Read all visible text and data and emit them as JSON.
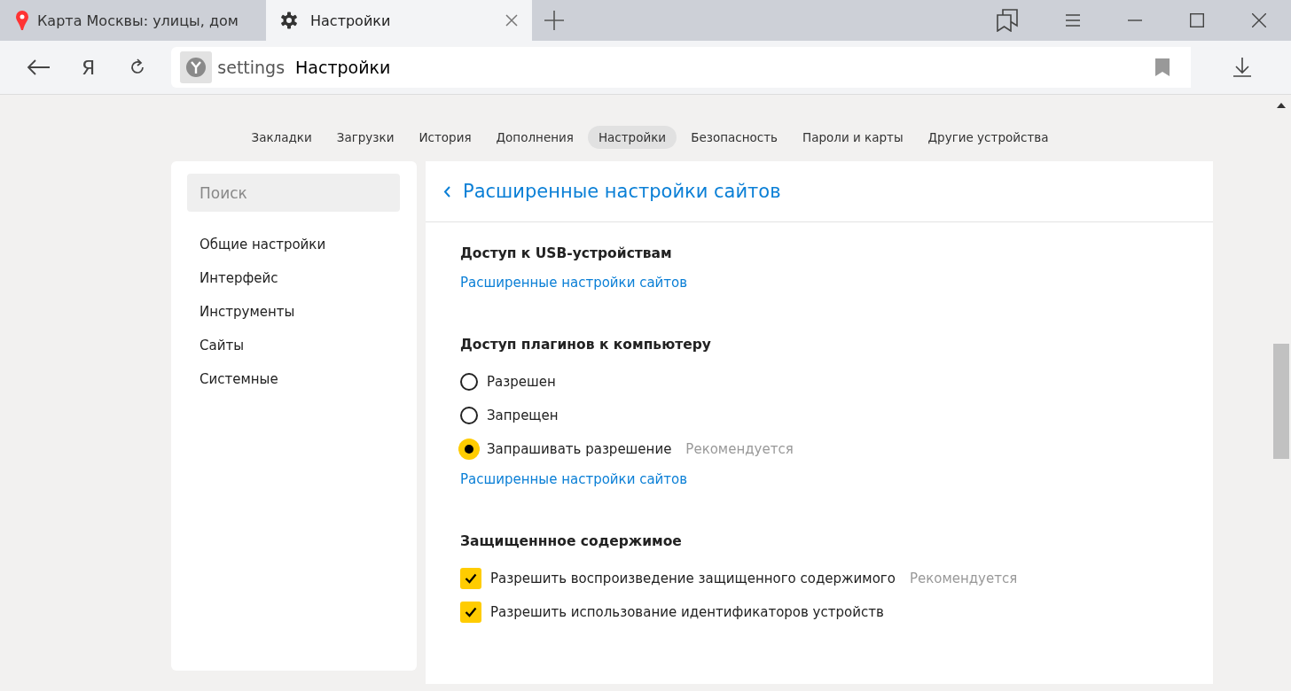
{
  "browser_tabs": [
    {
      "title": "Карта Москвы: улицы, дом",
      "kind": "map",
      "selected": false
    },
    {
      "title": "Настройки",
      "kind": "settings",
      "selected": true
    }
  ],
  "toolbar": {
    "yandex_button": "Я"
  },
  "address_bar": {
    "scheme": "settings",
    "title": "Настройки"
  },
  "nav": [
    {
      "label": "Закладки",
      "selected": false
    },
    {
      "label": "Загрузки",
      "selected": false
    },
    {
      "label": "История",
      "selected": false
    },
    {
      "label": "Дополнения",
      "selected": false
    },
    {
      "label": "Настройки",
      "selected": true
    },
    {
      "label": "Безопасность",
      "selected": false
    },
    {
      "label": "Пароли и карты",
      "selected": false
    },
    {
      "label": "Другие устройства",
      "selected": false
    }
  ],
  "sidebar": {
    "search": {
      "placeholder": "Поиск"
    },
    "items": [
      "Общие настройки",
      "Интерфейс",
      "Инструменты",
      "Сайты",
      "Системные"
    ]
  },
  "panel": {
    "title": "Расширенные настройки сайтов",
    "sections": [
      {
        "title": "Доступ к USB-устройствам",
        "link": "Расширенные настройки сайтов"
      },
      {
        "title": "Доступ плагинов к компьютеру",
        "options": [
          {
            "kind": "radio",
            "label": "Разрешен",
            "selected": false
          },
          {
            "kind": "radio",
            "label": "Запрещен",
            "selected": false
          },
          {
            "kind": "radio",
            "label": "Запрашивать разрешение",
            "hint": "Рекомендуется",
            "selected": true
          }
        ],
        "link": "Расширенные настройки сайтов"
      },
      {
        "title": "Защищеннное содержимое",
        "options": [
          {
            "kind": "checkbox",
            "label": "Разрешить воспроизведение защищенного содержимого",
            "hint": "Рекомендуется",
            "checked": true
          },
          {
            "kind": "checkbox",
            "label": "Разрешить использование идентификаторов устройств",
            "checked": true
          }
        ]
      }
    ]
  }
}
